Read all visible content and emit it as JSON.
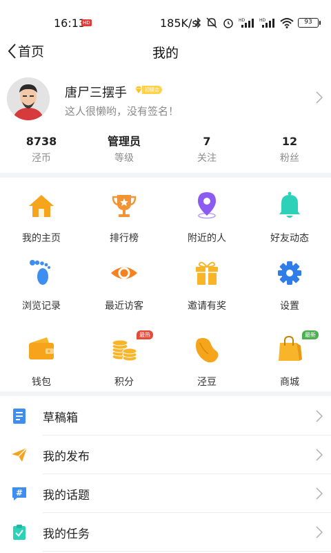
{
  "status_bar": {
    "time": "16:13",
    "time_badge": "HD",
    "net_speed": "185K/s",
    "battery": "93"
  },
  "nav": {
    "back_label": "首页",
    "title": "我的"
  },
  "profile": {
    "username": "唐尸三摆手",
    "level_badge": "初级会",
    "signature": "这人很懒哟，没有签名！"
  },
  "stats": [
    {
      "value": "8738",
      "label": "泾币"
    },
    {
      "value": "管理员",
      "label": "等级"
    },
    {
      "value": "7",
      "label": "关注"
    },
    {
      "value": "12",
      "label": "粉丝"
    }
  ],
  "grid": [
    {
      "label": "我的主页",
      "icon": "home-icon"
    },
    {
      "label": "排行榜",
      "icon": "trophy-icon"
    },
    {
      "label": "附近的人",
      "icon": "location-pin-icon"
    },
    {
      "label": "好友动态",
      "icon": "bell-icon"
    },
    {
      "label": "浏览记录",
      "icon": "footprint-icon"
    },
    {
      "label": "最近访客",
      "icon": "eye-icon"
    },
    {
      "label": "邀请有奖",
      "icon": "gift-icon"
    },
    {
      "label": "设置",
      "icon": "gear-icon"
    },
    {
      "label": "钱包",
      "icon": "wallet-icon"
    },
    {
      "label": "积分",
      "icon": "coins-icon",
      "tag": "最热",
      "tag_color": "#e64a3b"
    },
    {
      "label": "泾豆",
      "icon": "bean-icon"
    },
    {
      "label": "商城",
      "icon": "shopping-bag-icon",
      "tag": "最新",
      "tag_color": "#4caf50"
    }
  ],
  "menu": [
    {
      "label": "草稿箱",
      "icon": "draft-icon"
    },
    {
      "label": "我的发布",
      "icon": "paper-plane-icon"
    },
    {
      "label": "我的话题",
      "icon": "hashtag-icon"
    },
    {
      "label": "我的任务",
      "icon": "task-clipboard-icon"
    }
  ],
  "colors": {
    "accent_orange": "#f7a41d",
    "accent_blue": "#3d8ef0",
    "accent_purple": "#8c5cf2",
    "accent_teal": "#2dd1b8"
  }
}
